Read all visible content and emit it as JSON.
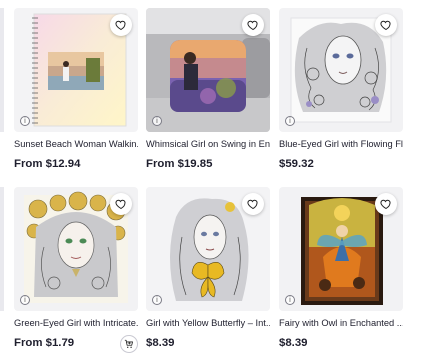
{
  "products": [
    {
      "title": "Sunset Beach Woman Walkin...",
      "price": "From $12.94",
      "favorite_icon": "heart-outline-icon",
      "info_icon": "info-icon"
    },
    {
      "title": "Whimsical Girl on Swing in En...",
      "price": "From $19.85",
      "favorite_icon": "heart-outline-icon",
      "info_icon": "info-icon"
    },
    {
      "title": "Blue-Eyed Girl with Flowing Fl...",
      "price": "$59.32",
      "favorite_icon": "heart-outline-icon",
      "info_icon": "info-icon"
    },
    {
      "title": "Green-Eyed Girl with Intricate...",
      "price": "From $1.79",
      "favorite_icon": "heart-outline-icon",
      "info_icon": "info-icon",
      "cart_icon": "add-to-cart-icon"
    },
    {
      "title": "Girl with Yellow Butterfly – Int...",
      "price": "$8.39",
      "favorite_icon": "heart-outline-icon",
      "info_icon": "info-icon"
    },
    {
      "title": "Fairy with Owl in Enchanted ...",
      "price": "$8.39",
      "favorite_icon": "heart-outline-icon",
      "info_icon": "info-icon"
    }
  ],
  "colors": {
    "text": "#1f1f2e",
    "thumb_bg": "#f1f1f4",
    "icon": "#222222"
  }
}
